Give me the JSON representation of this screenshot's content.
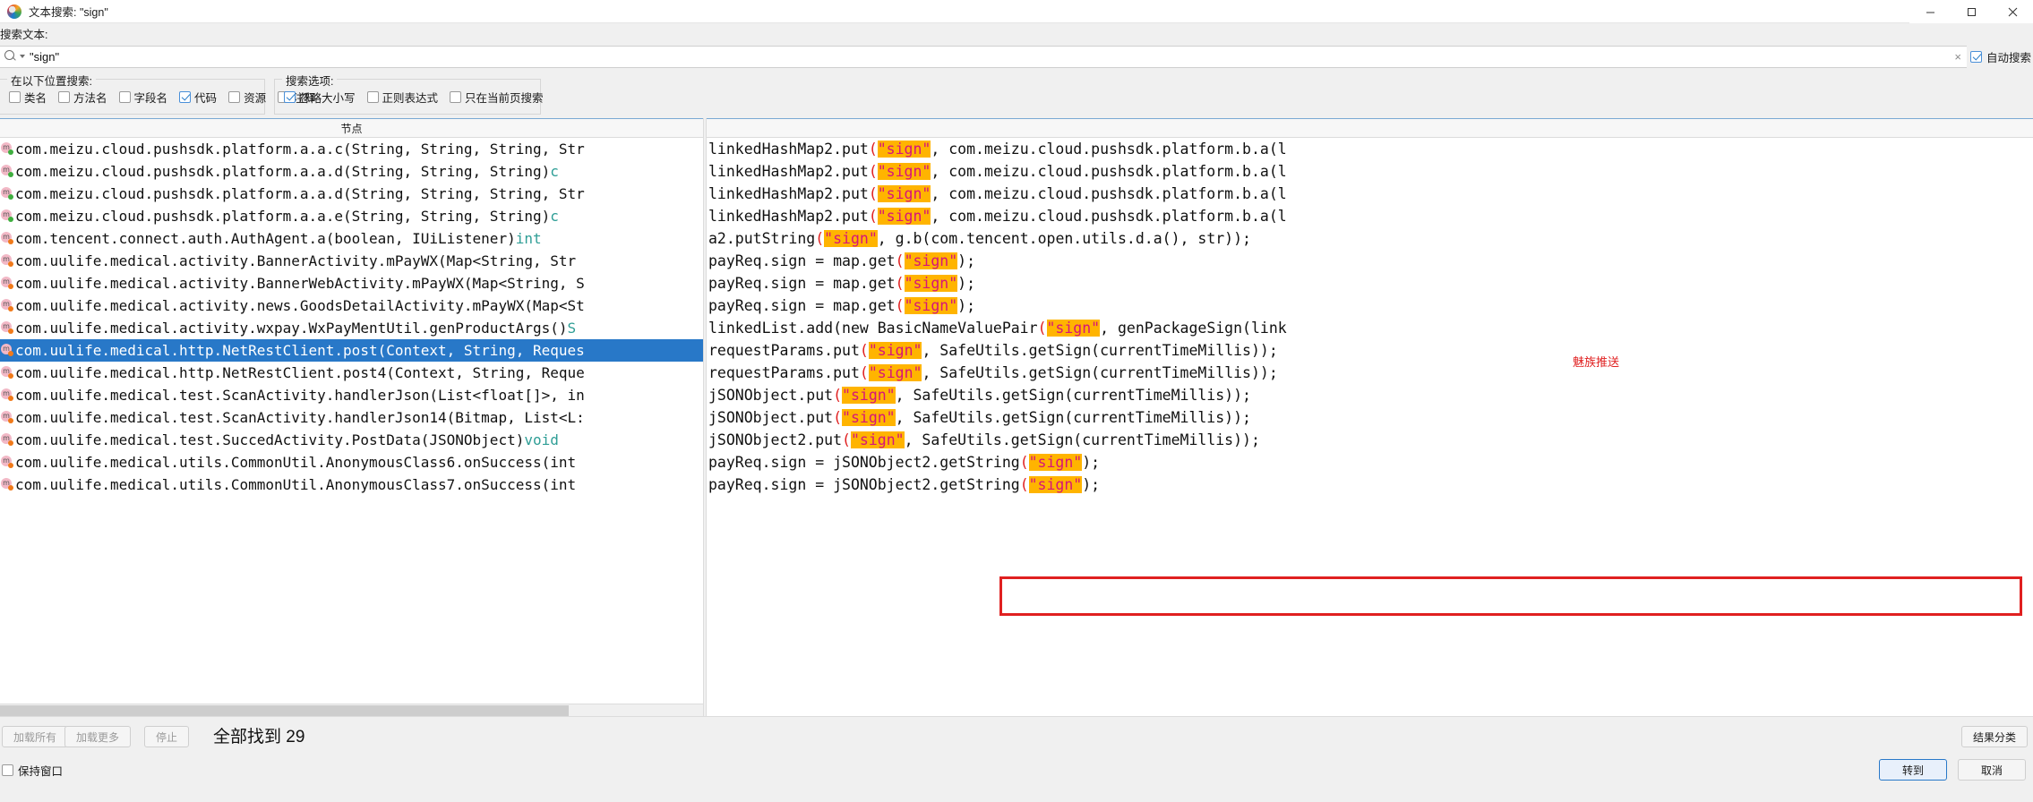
{
  "window": {
    "title": "文本搜索: \"sign\"",
    "icon": "app-icon",
    "minimize": "—",
    "maximize": "☐",
    "close": "✕"
  },
  "search": {
    "label": "搜索文本:",
    "value": "\"sign\"",
    "placeholder": "",
    "clear": "×",
    "auto_search_label": "自动搜索",
    "auto_search_checked": true
  },
  "locations": {
    "title": "在以下位置搜索:",
    "items": [
      {
        "label": "类名",
        "checked": false
      },
      {
        "label": "方法名",
        "checked": false
      },
      {
        "label": "字段名",
        "checked": false
      },
      {
        "label": "代码",
        "checked": true
      },
      {
        "label": "资源",
        "checked": false
      },
      {
        "label": "注释",
        "checked": false
      }
    ]
  },
  "options": {
    "title": "搜索选项:",
    "items": [
      {
        "label": "忽略大小写",
        "checked": true
      },
      {
        "label": "正则表达式",
        "checked": false
      },
      {
        "label": "只在当前页搜索",
        "checked": false
      }
    ]
  },
  "tree": {
    "header": "节点",
    "rows": [
      {
        "pkg": "com.meizu.cloud.pushsdk.platform.a.a.c(String, String, String, Str",
        "tail": "",
        "icon_variant": "green",
        "selected": false
      },
      {
        "pkg": "com.meizu.cloud.pushsdk.platform.a.a.d(String, String, String)",
        "tail": " c",
        "icon_variant": "green",
        "selected": false
      },
      {
        "pkg": "com.meizu.cloud.pushsdk.platform.a.a.d(String, String, String, Str",
        "tail": "",
        "icon_variant": "green",
        "selected": false
      },
      {
        "pkg": "com.meizu.cloud.pushsdk.platform.a.a.e(String, String, String)",
        "tail": " c",
        "icon_variant": "green",
        "selected": false
      },
      {
        "pkg": "com.tencent.connect.auth.AuthAgent.a(boolean, IUiListener)",
        "tail": " int",
        "icon_variant": "orange",
        "selected": false
      },
      {
        "pkg": "com.uulife.medical.activity.BannerActivity.mPayWX(Map<String, Str",
        "tail": "",
        "icon_variant": "orange",
        "selected": false
      },
      {
        "pkg": "com.uulife.medical.activity.BannerWebActivity.mPayWX(Map<String, S",
        "tail": "",
        "icon_variant": "orange",
        "selected": false
      },
      {
        "pkg": "com.uulife.medical.activity.news.GoodsDetailActivity.mPayWX(Map<St",
        "tail": "",
        "icon_variant": "orange",
        "selected": false
      },
      {
        "pkg": "com.uulife.medical.activity.wxpay.WxPayMentUtil.genProductArgs()",
        "tail": " S",
        "icon_variant": "orange",
        "selected": false
      },
      {
        "pkg": "com.uulife.medical.http.NetRestClient.post(Context, String, Reques",
        "tail": "",
        "icon_variant": "orange",
        "selected": true
      },
      {
        "pkg": "com.uulife.medical.http.NetRestClient.post4(Context, String, Reque",
        "tail": "",
        "icon_variant": "orange",
        "selected": false
      },
      {
        "pkg": "com.uulife.medical.test.ScanActivity.handlerJson(List<float[]>, in",
        "tail": "",
        "icon_variant": "orange",
        "selected": false
      },
      {
        "pkg": "com.uulife.medical.test.ScanActivity.handlerJson14(Bitmap, List<L:",
        "tail": "",
        "icon_variant": "orange",
        "selected": false
      },
      {
        "pkg": "com.uulife.medical.test.SuccedActivity.PostData(JSONObject)",
        "tail": " void",
        "icon_variant": "orange",
        "selected": false
      },
      {
        "pkg": "com.uulife.medical.utils.CommonUtil.AnonymousClass6.onSuccess(int",
        "tail": "",
        "icon_variant": "orange",
        "selected": false
      },
      {
        "pkg": "com.uulife.medical.utils.CommonUtil.AnonymousClass7.onSuccess(int",
        "tail": "",
        "icon_variant": "orange",
        "selected": false
      }
    ]
  },
  "code": {
    "rows": [
      {
        "pre": "linkedHashMap2.put(",
        "hl": "\"sign\"",
        "post": ", com.meizu.cloud.pushsdk.platform.b.a(l",
        "boxed": false
      },
      {
        "pre": "linkedHashMap2.put(",
        "hl": "\"sign\"",
        "post": ", com.meizu.cloud.pushsdk.platform.b.a(l",
        "boxed": false
      },
      {
        "pre": "linkedHashMap2.put(",
        "hl": "\"sign\"",
        "post": ", com.meizu.cloud.pushsdk.platform.b.a(l",
        "boxed": false
      },
      {
        "pre": "linkedHashMap2.put(",
        "hl": "\"sign\"",
        "post": ", com.meizu.cloud.pushsdk.platform.b.a(l",
        "boxed": false
      },
      {
        "pre": "a2.putString(",
        "hl": "\"sign\"",
        "post": ", g.b(com.tencent.open.utils.d.a(), str));",
        "boxed": false
      },
      {
        "pre": "payReq.sign = map.get(",
        "hl": "\"sign\"",
        "post": ");",
        "boxed": false
      },
      {
        "pre": "payReq.sign = map.get(",
        "hl": "\"sign\"",
        "post": ");",
        "boxed": false
      },
      {
        "pre": "payReq.sign = map.get(",
        "hl": "\"sign\"",
        "post": ");",
        "boxed": false
      },
      {
        "pre": "linkedList.add(new BasicNameValuePair(",
        "hl": "\"sign\"",
        "post": ", genPackageSign(link",
        "boxed": false
      },
      {
        "pre": "requestParams.put(",
        "hl": "\"sign\"",
        "post": ", SafeUtils.getSign(currentTimeMillis));",
        "boxed": true
      },
      {
        "pre": "requestParams.put(",
        "hl": "\"sign\"",
        "post": ", SafeUtils.getSign(currentTimeMillis));",
        "boxed": false
      },
      {
        "pre": "jSONObject.put(",
        "hl": "\"sign\"",
        "post": ", SafeUtils.getSign(currentTimeMillis));",
        "boxed": false
      },
      {
        "pre": "jSONObject.put(",
        "hl": "\"sign\"",
        "post": ", SafeUtils.getSign(currentTimeMillis));",
        "boxed": false
      },
      {
        "pre": "jSONObject2.put(",
        "hl": "\"sign\"",
        "post": ", SafeUtils.getSign(currentTimeMillis));",
        "boxed": false
      },
      {
        "pre": "payReq.sign = jSONObject2.getString(",
        "hl": "\"sign\"",
        "post": ");",
        "boxed": false
      },
      {
        "pre": "payReq.sign = jSONObject2.getString(",
        "hl": "\"sign\"",
        "post": ");",
        "boxed": false
      }
    ],
    "annotation": "魅族推送",
    "annotation_color": "#e02020",
    "highlight_color": "#ffb400"
  },
  "bottom": {
    "load_all": "加载所有",
    "load_more": "加载更多",
    "stop": "停止",
    "found_text": "全部找到  29",
    "classify": "结果分类",
    "keep_window": "保持窗口",
    "keep_window_checked": false,
    "goto": "转到",
    "cancel": "取消"
  }
}
